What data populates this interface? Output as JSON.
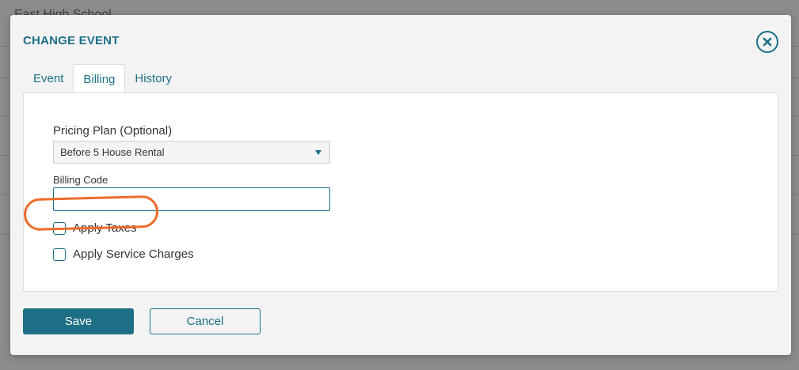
{
  "backdrop": {
    "title": "East High School"
  },
  "modal": {
    "title": "CHANGE EVENT",
    "close_icon": "close-circle-icon"
  },
  "tabs": [
    {
      "label": "Event",
      "active": false
    },
    {
      "label": "Billing",
      "active": true
    },
    {
      "label": "History",
      "active": false
    }
  ],
  "billing": {
    "pricing_plan": {
      "label": "Pricing Plan (Optional)",
      "selected": "Before 5 House Rental"
    },
    "billing_code": {
      "label": "Billing Code",
      "value": "",
      "placeholder": ""
    },
    "apply_taxes": {
      "label": "Apply Taxes",
      "checked": false
    },
    "apply_service_charges": {
      "label": "Apply Service Charges",
      "checked": false
    }
  },
  "actions": {
    "save_label": "Save",
    "cancel_label": "Cancel"
  },
  "colors": {
    "accent": "#1d6f86",
    "annotation": "#ee6a2b"
  }
}
